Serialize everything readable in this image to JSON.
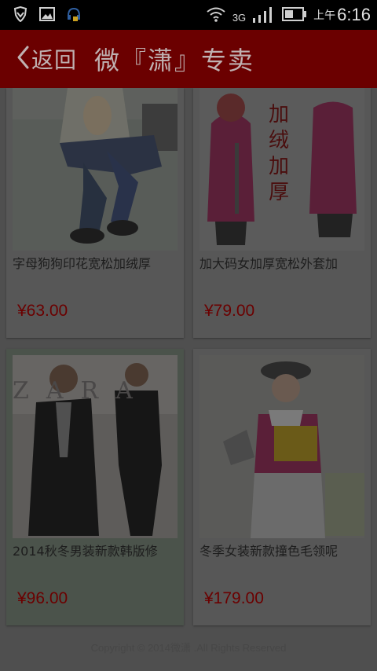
{
  "status_bar": {
    "network": "3G",
    "time_prefix": "上午",
    "time": "6:16",
    "icons": [
      "shield-icon",
      "image-icon",
      "headset-icon",
      "wifi-icon",
      "signal-icon",
      "battery-icon"
    ]
  },
  "header": {
    "back_label": "返回",
    "title": "微『潇』专卖"
  },
  "products": [
    {
      "name": "字母狗狗印花宽松加绒厚",
      "price": "¥63.00",
      "photo_text": ""
    },
    {
      "name": "加大码女加厚宽松外套加",
      "price": "¥79.00",
      "photo_text": "加绒加厚"
    },
    {
      "name": "2014秋冬男装新款韩版修",
      "price": "¥96.00",
      "photo_text": "ZARA"
    },
    {
      "name": "冬季女装新款撞色毛领呢",
      "price": "¥179.00",
      "photo_text": ""
    }
  ],
  "footer": "Copyright © 2014微潇 .All Rights Reserved",
  "colors": {
    "header": "#6b0000",
    "price": "#6b0000",
    "overlay_background": "#4f4f4f"
  }
}
